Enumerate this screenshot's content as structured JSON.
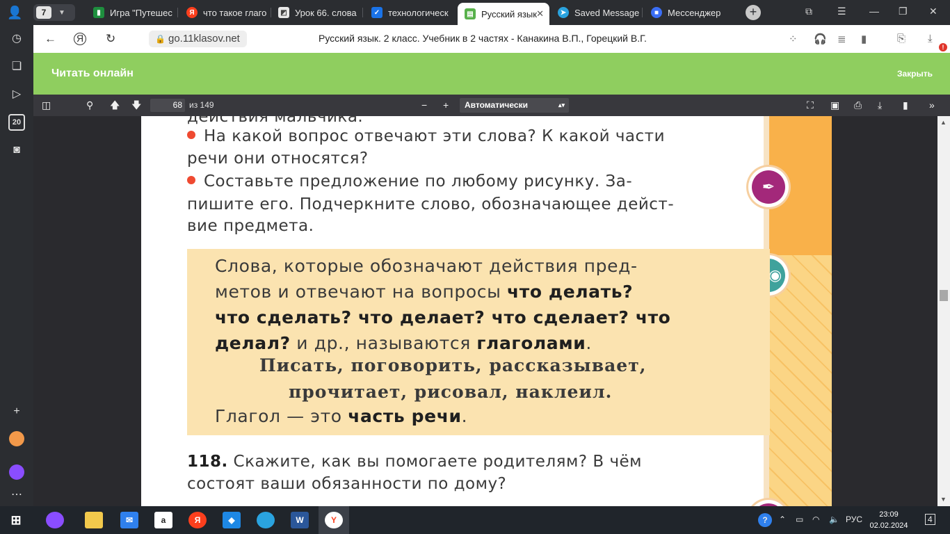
{
  "tabs": {
    "group_count": "7",
    "items": [
      {
        "title": "Игра \"Путешес",
        "icon": "spreadsheet-green-icon",
        "color": "#1e8e3e",
        "glyph": "▮"
      },
      {
        "title": "что такое глаго",
        "icon": "yandex-icon",
        "color": "#fc3f1d",
        "glyph": "Я"
      },
      {
        "title": "Урок 66. слова",
        "icon": "presentation-icon",
        "color": "#e8e8e8",
        "glyph": "◩"
      },
      {
        "title": "технологическ",
        "icon": "checkmark-icon",
        "color": "#1a73e8",
        "glyph": "✓"
      },
      {
        "title": "Русский язык",
        "icon": "book-icon",
        "color": "#58b14b",
        "glyph": "📖",
        "active": true
      },
      {
        "title": "Saved Message",
        "icon": "telegram-icon",
        "color": "#2aa3df",
        "glyph": "➤"
      },
      {
        "title": "Мессенджер",
        "icon": "messenger-icon",
        "color": "#3b6ef5",
        "glyph": "■"
      }
    ]
  },
  "address_bar": {
    "url": "go.11klasov.net",
    "title": "Русский язык. 2 класс. Учебник в 2 частях - Канакина В.П., Горецкий В.Г.",
    "download_badge": "!"
  },
  "reader": {
    "title": "Читать онлайн",
    "close": "Закрыть"
  },
  "pdf_toolbar": {
    "page": "68",
    "of_total": "из 149",
    "zoom": "Автоматически"
  },
  "sidebar_badge": "20",
  "document": {
    "line_top": "действия мальчика.",
    "q1_line1": "На какой вопрос отвечают эти слова? К какой части",
    "q1_line2": "речи они относятся?",
    "q2_line1": "Составьте предложение по любому рисунку. За-",
    "q2_line2": "пишите его. Подчеркните слово, обозначающее дейст-",
    "q2_line3": "вие предмета.",
    "rule": {
      "l1": "Слова, которые обозначают действия пред-",
      "l2_plain": "метов и отвечают на вопросы ",
      "l2_bold": "что делать?",
      "l3_bold": "что сделать? что делает? что сделает? что",
      "l4_bold1": "делал?",
      "l4_plain": " и др., называются ",
      "l4_bold2": "глаголами",
      "l4_end": ".",
      "ex1": "Писать, поговорить, рассказывает,",
      "ex2": "прочитает, рисовал, наклеил.",
      "l7_plain": "Глагол — это ",
      "l7_bold": "часть речи",
      "l7_end": "."
    },
    "ex118_num": "118.",
    "ex118_line1": " Скажите, как вы помогаете родителям? В чём",
    "ex118_line2": "состоят ваши обязанности по дому?"
  },
  "taskbar": {
    "lang": "РУС",
    "time": "23:09",
    "date": "02.02.2024",
    "notifications": "4"
  },
  "colors": {
    "reader_green": "#8fce5f",
    "rule_box": "#fbe3b0",
    "bullet_red": "#ef4a31",
    "badge_purple": "#a3287a",
    "badge_teal": "#3fa29c"
  }
}
